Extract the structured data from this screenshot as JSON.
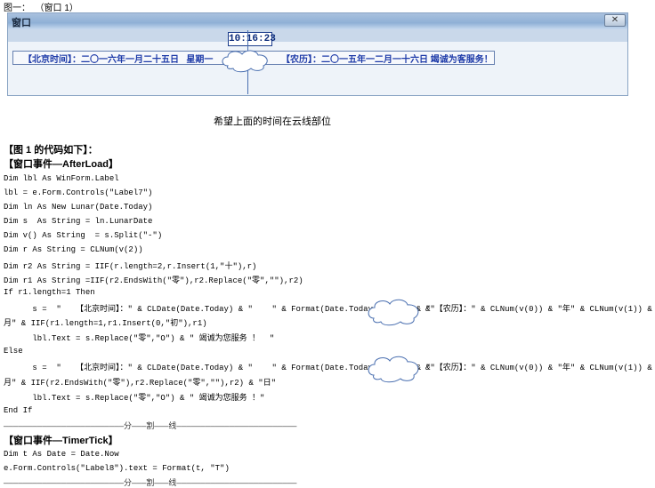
{
  "figure_label": "图一：  （窗口 1）",
  "window": {
    "title": "窗口",
    "close_symbol": "✕",
    "clock": "10:16:23",
    "marquee_left": "【北京时间】：二〇一六年一月二十五日   星期一",
    "marquee_right": "【农历】：二〇一五年一二月一十六日 竭诚为客服务！"
  },
  "note": "希望上面的时间在云线部位",
  "section1_title": "【图 1 的代码如下】：",
  "section1_event": "【窗口事件—AfterLoad】",
  "code_lines": [
    "Dim lbl As WinForm.Label",
    "lbl = e.Form.Controls(\"Label7\")",
    "Dim ln As New Lunar(Date.Today)",
    "Dim s  As String = ln.LunarDate",
    "Dim v() As String  = s.Split(\"-\")",
    "Dim r As String = CLNum(v(2))",
    "Dim r2 As String = IIF(r.length=2,r.Insert(1,\"十\"),r)",
    "Dim r1 As String =IIF(r2.EndsWith(\"零\"),r2.Replace(\"零\",\"\"),r2)",
    "If r1.length=1 Then",
    "      s =  \"   【北京时间】：\" & CLDate(Date.Today) & \"    \" & Format(Date.Today,\"dddd\") & \"",
    "月\" & IIF(r1.length=1,r1.Insert(0,\"初\"),r1)",
    "      lbl.Text = s.Replace(\"零\",\"O\") & \" 竭诚为您服务 ！  \"",
    "Else",
    "      s =  \"   【北京时间】：\" & CLDate(Date.Today) & \"    \" & Format(Date.Today,\"dddd\") & \"",
    "月\" & IIF(r2.EndsWith(\"零\"),r2.Replace(\"零\",\"\"),r2) & \"日\"",
    "      lbl.Text = s.Replace(\"零\",\"O\") & \" 竭诚为您服务 ！\"",
    "End If"
  ],
  "code_tail_1": "&\"【农历】：\" & CLNum(v(0)) & \"年\" & CLNum(v(1)) & \"",
  "code_tail_2": "&\"【农历】：\" & CLNum(v(0)) & \"年\" & CLNum(v(1)) & \"",
  "separator": "—————————————————————————分———割———线—————————————————————————",
  "section2_event": "【窗口事件—TimerTick】",
  "code2_lines": [
    "Dim t As Date = Date.Now",
    "e.Form.Controls(\"Label8\").text = Format(t, \"T\")"
  ],
  "separator2": "—————————————————————————分———割———线—————————————————————————"
}
